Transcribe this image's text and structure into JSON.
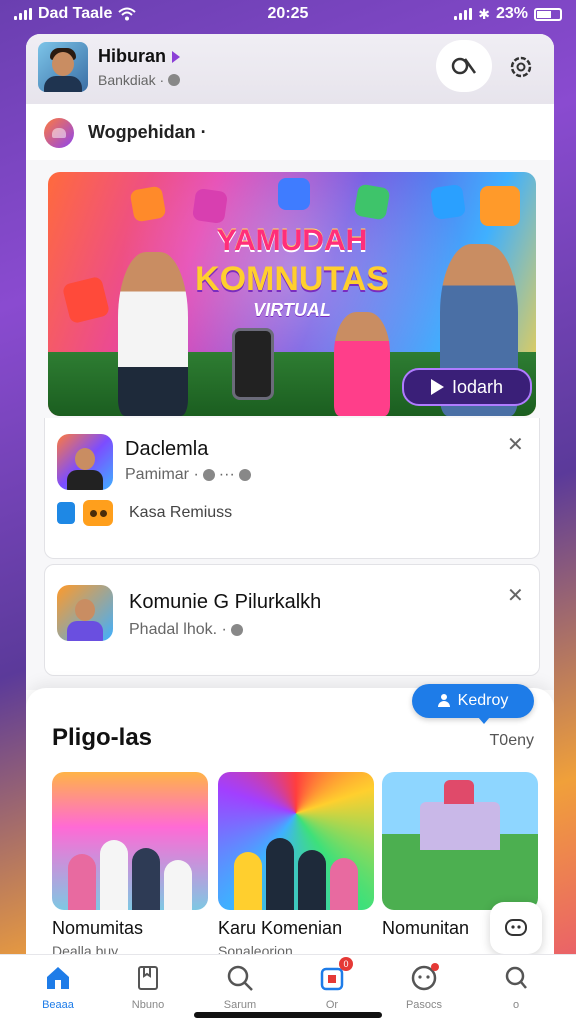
{
  "status": {
    "carrier": "Dad Taale",
    "time": "20:25",
    "battery": "23%",
    "battery_level": 0.23
  },
  "header": {
    "title": "Hiburan",
    "subtitle": "Bankdiak ·"
  },
  "community": {
    "name": "Wogpehidan ·"
  },
  "banner": {
    "line1": "YAMUDAH",
    "line2": "KOMNUTAS",
    "line3": "VIRTUAL",
    "watch_label": "Iodarh"
  },
  "cards": [
    {
      "title": "Daclemla",
      "subtitle": "Pamimar · ",
      "tag": "Kasa Remiuss"
    },
    {
      "title": "Komunie G Pilurkalkh",
      "subtitle": "Phadal lhok. · "
    }
  ],
  "section": {
    "title": "Pligo-las",
    "link": "T0eny",
    "follow_label": "Kedroy",
    "items": [
      {
        "label": "Nomumitas",
        "sub": "Dealla buy"
      },
      {
        "label": "Karu Komenian",
        "sub": "Sonaleorion"
      },
      {
        "label": "Nomunitan",
        "sub": ""
      }
    ]
  },
  "nav": [
    {
      "label": "Beaaa",
      "icon": "home-icon",
      "active": true
    },
    {
      "label": "Nbuno",
      "icon": "bookmark-icon",
      "active": false
    },
    {
      "label": "Sarum",
      "icon": "search-icon",
      "active": false
    },
    {
      "label": "Or",
      "icon": "inbox-icon",
      "active": false,
      "badge": "0"
    },
    {
      "label": "Pasocs",
      "icon": "chat-icon",
      "active": false
    },
    {
      "label": "o",
      "icon": "profile-search-icon",
      "active": false
    }
  ],
  "colors": {
    "accent": "#1e7ce8",
    "banner_dark": "#3a1f78",
    "badge": "#e53935"
  }
}
